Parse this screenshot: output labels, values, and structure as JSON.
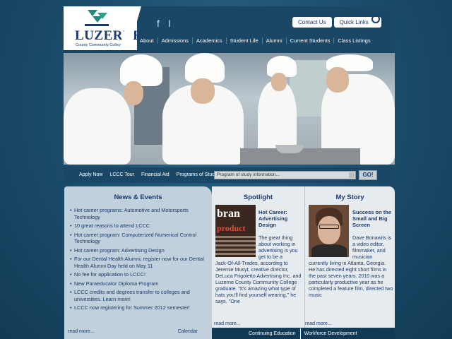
{
  "logo": {
    "name": "LUZERNE",
    "subtitle": "County Community College"
  },
  "social": [
    "f",
    "I"
  ],
  "top_links": {
    "contact": "Contact Us",
    "quick": "Quick Links"
  },
  "nav": [
    "About",
    "Admissions",
    "Academics",
    "Student Life",
    "Alumni",
    "Current Students",
    "Class Listings"
  ],
  "quick_bar": {
    "links": [
      "Apply Now",
      "LCCC Tour",
      "Financial Aid",
      "Programs of Study:"
    ],
    "select_value": "Program of study information...",
    "go": "GO!"
  },
  "news": {
    "title": "News & Events",
    "items": [
      "Hot career programs: Automotive and Motorsports Technology",
      "10 great reasons to attend LCCC",
      "Hot career program: Computerized Numerical Control Technology",
      "Hot career program: Advertising Design",
      "For our Dental Health Alumni, register now for our Dental Health Alumni Day held on May 11",
      "No fee for application to LCCC!",
      "New Paraeducator Diploma Program",
      "LCCC credits and degrees transfer to colleges and universities. Learn more!",
      "LCCC now registering for Summer 2012 semester!"
    ],
    "read_more": "read more...",
    "calendar": "Calendar"
  },
  "spotlight": {
    "title": "Spotlight",
    "headline": "Hot Career: Advertising Design",
    "body": "The great thing about working in advertising is you get to be a",
    "body2": "Jack-Of-All-Trades, according to Jeremie Musyt, creative director, DeLuca Frigoletto Advertising Inc. and Luzerne County Community College graduate. \"It's amazing what type of hats you'll find yourself wearing,\" he says. \"One",
    "read_more": "read more..."
  },
  "story": {
    "title": "My Story",
    "headline": "Success on the Small and Big Screen",
    "body": "Dave Bonawits is a video editor, filmmaker, and musician",
    "body2": "currently living in Atlanta, Georgia. He has directed eight short films in the past seven years. 2010 was a particularly productive year as he completed a feature film, directed two music",
    "read_more": "read more..."
  },
  "bottom_nav": [
    "Continuing Education",
    "Workforce Development"
  ]
}
